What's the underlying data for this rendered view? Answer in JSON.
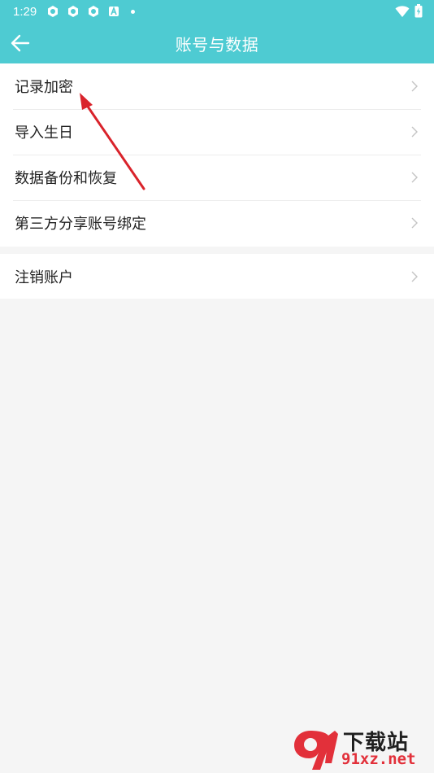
{
  "status_bar": {
    "time": "1:29",
    "icons": [
      "app-notification-icon",
      "app-notification-icon",
      "app-notification-icon",
      "a-notification-icon",
      "dot-icon"
    ],
    "right_icons": [
      "wifi-icon",
      "battery-charging-icon"
    ]
  },
  "header": {
    "title": "账号与数据",
    "background": "#4ecbd2"
  },
  "groups": [
    {
      "items": [
        {
          "label": "记录加密"
        },
        {
          "label": "导入生日"
        },
        {
          "label": "数据备份和恢复"
        },
        {
          "label": "第三方分享账号绑定"
        }
      ]
    },
    {
      "items": [
        {
          "label": "注销账户"
        }
      ]
    }
  ],
  "annotation": {
    "color": "#d9232b"
  },
  "watermark": {
    "title": "下载站",
    "url": "91xz.net",
    "color": "#e2303a"
  }
}
